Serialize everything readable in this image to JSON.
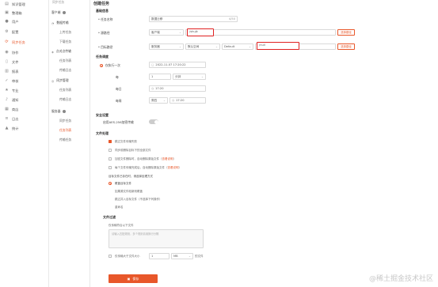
{
  "sidebar": {
    "items": [
      {
        "label": "知识管理",
        "icon": "book-icon"
      },
      {
        "label": "整理箱",
        "icon": "box-icon"
      },
      {
        "label": "用户",
        "icon": "user-icon"
      },
      {
        "label": "配置",
        "icon": "settings-icon"
      },
      {
        "label": "同步任务",
        "icon": "sync-icon",
        "active": true
      },
      {
        "label": "协作",
        "icon": "team-icon"
      },
      {
        "label": "文件",
        "icon": "file-icon"
      },
      {
        "label": "报表",
        "icon": "chart-icon"
      },
      {
        "label": "审核",
        "icon": "audit-icon"
      },
      {
        "label": "专业",
        "icon": "star-icon"
      },
      {
        "label": "通知",
        "icon": "bell-icon"
      },
      {
        "label": "商店",
        "icon": "store-icon"
      },
      {
        "label": "日志",
        "icon": "log-icon"
      },
      {
        "label": "统计",
        "icon": "stats-icon"
      }
    ]
  },
  "subnav": {
    "top_label": "同步任务",
    "groups": [
      {
        "label": "客户端",
        "items": []
      },
      {
        "label": "数据传输",
        "items": [
          "上传任务",
          "下载任务"
        ]
      },
      {
        "label": "点对点传输",
        "items": [
          "任务列表",
          "传输日志"
        ]
      },
      {
        "label": "同步管理",
        "items": [
          "任务列表",
          "传输日志"
        ]
      },
      {
        "label": "服务器",
        "items": [
          "同步任务",
          "任务列表",
          "传输任务"
        ]
      }
    ],
    "active_item": "任务列表"
  },
  "content": {
    "page_title": "创建任务",
    "basic": {
      "header": "基础信息",
      "task_name_label": "* 任务名称",
      "task_name_value": "数据迁移",
      "task_name_counter": "4/50",
      "source_label": "* 源路径",
      "source_type": "客户端",
      "source_path": "/shujk",
      "source_button": "选择路径",
      "target_label": "* 目标路径",
      "target_type": "服务器",
      "target_region": "默认空间",
      "target_mode": "Default",
      "target_path": "/null",
      "target_button": "选择路径"
    },
    "schedule": {
      "header": "任务调度",
      "once_label": "仅执行一次",
      "once_value": "2022-11-07 17:20:22",
      "every_label": "每",
      "every_value": "1",
      "every_unit": "分钟",
      "daily_label": "每日",
      "daily_value": "17:20",
      "weekly_label": "每周",
      "weekly_day": "周四",
      "weekly_time": "17:20"
    },
    "security": {
      "header": "安全设置",
      "aes_label": "启用AES-256加密传输"
    },
    "file_handling": {
      "header": "文件处理",
      "retry_label": "跳过文件传输失败",
      "overwrite_label": "同步前删除目标下的全部文件",
      "scan_label": "加密文件删除时，自动删除原始文件（",
      "scan_link": "查看说明",
      "scan_tail": "）",
      "delete_label": "每个文件传输完成后，自动删除原始文件（",
      "delete_link": "查看说明",
      "delete_tail": "）",
      "conflict_header": "目标文件已存在时，请选择处理方式",
      "conflict_options": [
        "覆盖目标文件",
        "如果源文件较新则覆盖",
        "跳过并入目标文件（不选择下列操作）",
        "重命名"
      ]
    },
    "filter": {
      "header": "文件过滤",
      "sub_label": "仅传输符合以下文件",
      "placeholder": "请输入匹配规则，多个规则请用换行分隔",
      "size_label": "仅传输大于文件大小",
      "size_value": "1",
      "size_unit": "MB",
      "size_tail": "的文件"
    },
    "save_label": "保存"
  },
  "watermark": "@稀土掘金技术社区"
}
